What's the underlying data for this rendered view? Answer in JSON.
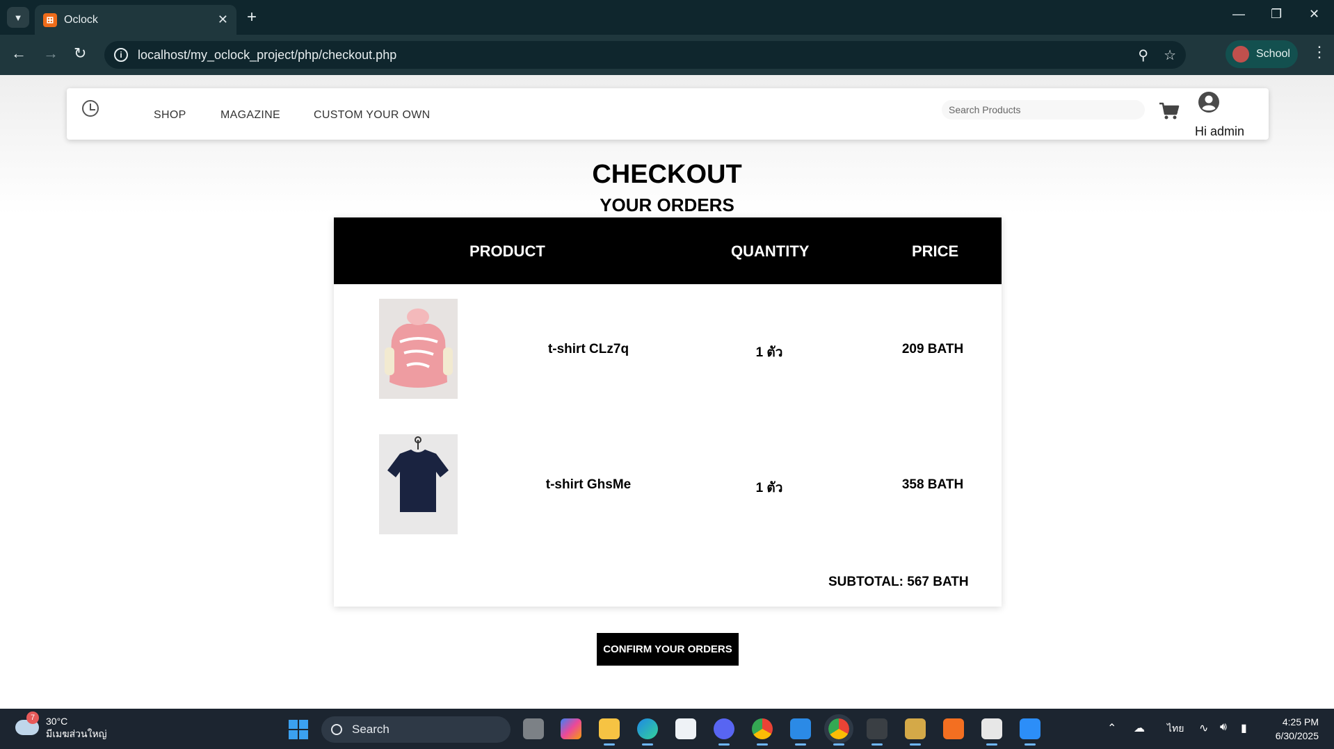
{
  "browser": {
    "tab_title": "Oclock",
    "tab_favicon_glyph": "⊞",
    "url": "localhost/my_oclock_project/php/checkout.php",
    "profile_label": "School"
  },
  "site": {
    "nav": [
      {
        "label": "SHOP"
      },
      {
        "label": "MAGAZINE"
      },
      {
        "label": "CUSTOM YOUR OWN"
      }
    ],
    "search_placeholder": "Search Products",
    "greeting": "Hi admin"
  },
  "checkout": {
    "title": "CHECKOUT",
    "subtitle": "YOUR ORDERS",
    "columns": {
      "product": "PRODUCT",
      "quantity": "QUANTITY",
      "price": "PRICE"
    },
    "items": [
      {
        "name": "t-shirt CLz7q",
        "quantity": "1 ตัว",
        "price": "209 BATH",
        "image_color": "#eb9a9e"
      },
      {
        "name": "t-shirt GhsMe",
        "quantity": "1 ตัว",
        "price": "358 BATH",
        "image_color": "#18213a"
      }
    ],
    "subtotal": "SUBTOTAL: 567 BATH",
    "confirm_label": "CONFIRM YOUR ORDERS"
  },
  "taskbar": {
    "weather_temp": "30°C",
    "weather_place": "มีเมฆส่วนใหญ่",
    "weather_badge": "7",
    "search_label": "Search",
    "language": "ไทย",
    "time": "4:25 PM",
    "date": "6/30/2025"
  },
  "colors": {
    "chrome_dark": "#0f262d",
    "chrome_toolbar": "#1f373d",
    "table_header": "#000000",
    "taskbar": "#1c2530"
  }
}
